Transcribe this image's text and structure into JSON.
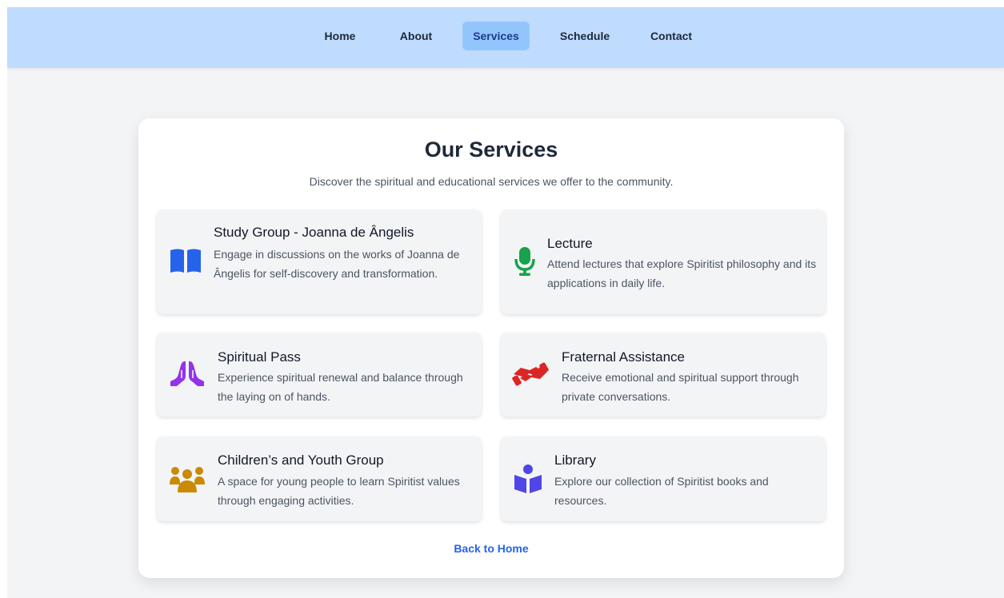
{
  "nav": {
    "items": [
      {
        "label": "Home"
      },
      {
        "label": "About"
      },
      {
        "label": "Services"
      },
      {
        "label": "Schedule"
      },
      {
        "label": "Contact"
      }
    ],
    "active": "Services"
  },
  "page": {
    "title": "Our Services",
    "subtitle": "Discover the spiritual and educational services we offer to the community."
  },
  "services": [
    {
      "name": "Study Group - Joanna de Ângelis",
      "description": "Engage in discussions on the works of Joanna de Ângelis for self-discovery and transformation.",
      "icon": "book-icon",
      "icon_color": "#2563eb"
    },
    {
      "name": "Lecture",
      "description": "Attend lectures that explore Spiritist philosophy and its applications in daily life.",
      "icon": "microphone-icon",
      "icon_color": "#16a34a"
    },
    {
      "name": "Spiritual Pass",
      "description": "Experience spiritual renewal and balance through the laying on of hands.",
      "icon": "praying-hands-icon",
      "icon_color": "#9333ea"
    },
    {
      "name": "Fraternal Assistance",
      "description": "Receive emotional and spiritual support through private conversations.",
      "icon": "handshake-icon",
      "icon_color": "#dc2626"
    },
    {
      "name": "Children’s and Youth Group",
      "description": "A space for young people to learn Spiritist values through engaging activities.",
      "icon": "people-group-icon",
      "icon_color": "#ca8a04"
    },
    {
      "name": "Library",
      "description": "Explore our collection of Spiritist books and resources.",
      "icon": "book-reader-icon",
      "icon_color": "#4f46e5"
    }
  ],
  "back_link": "Back to Home",
  "colors": {
    "navbar_bg": "#bfdbfe",
    "nav_active_bg": "#93c5fd",
    "page_bg": "#f3f4f6",
    "link": "#2563eb"
  }
}
